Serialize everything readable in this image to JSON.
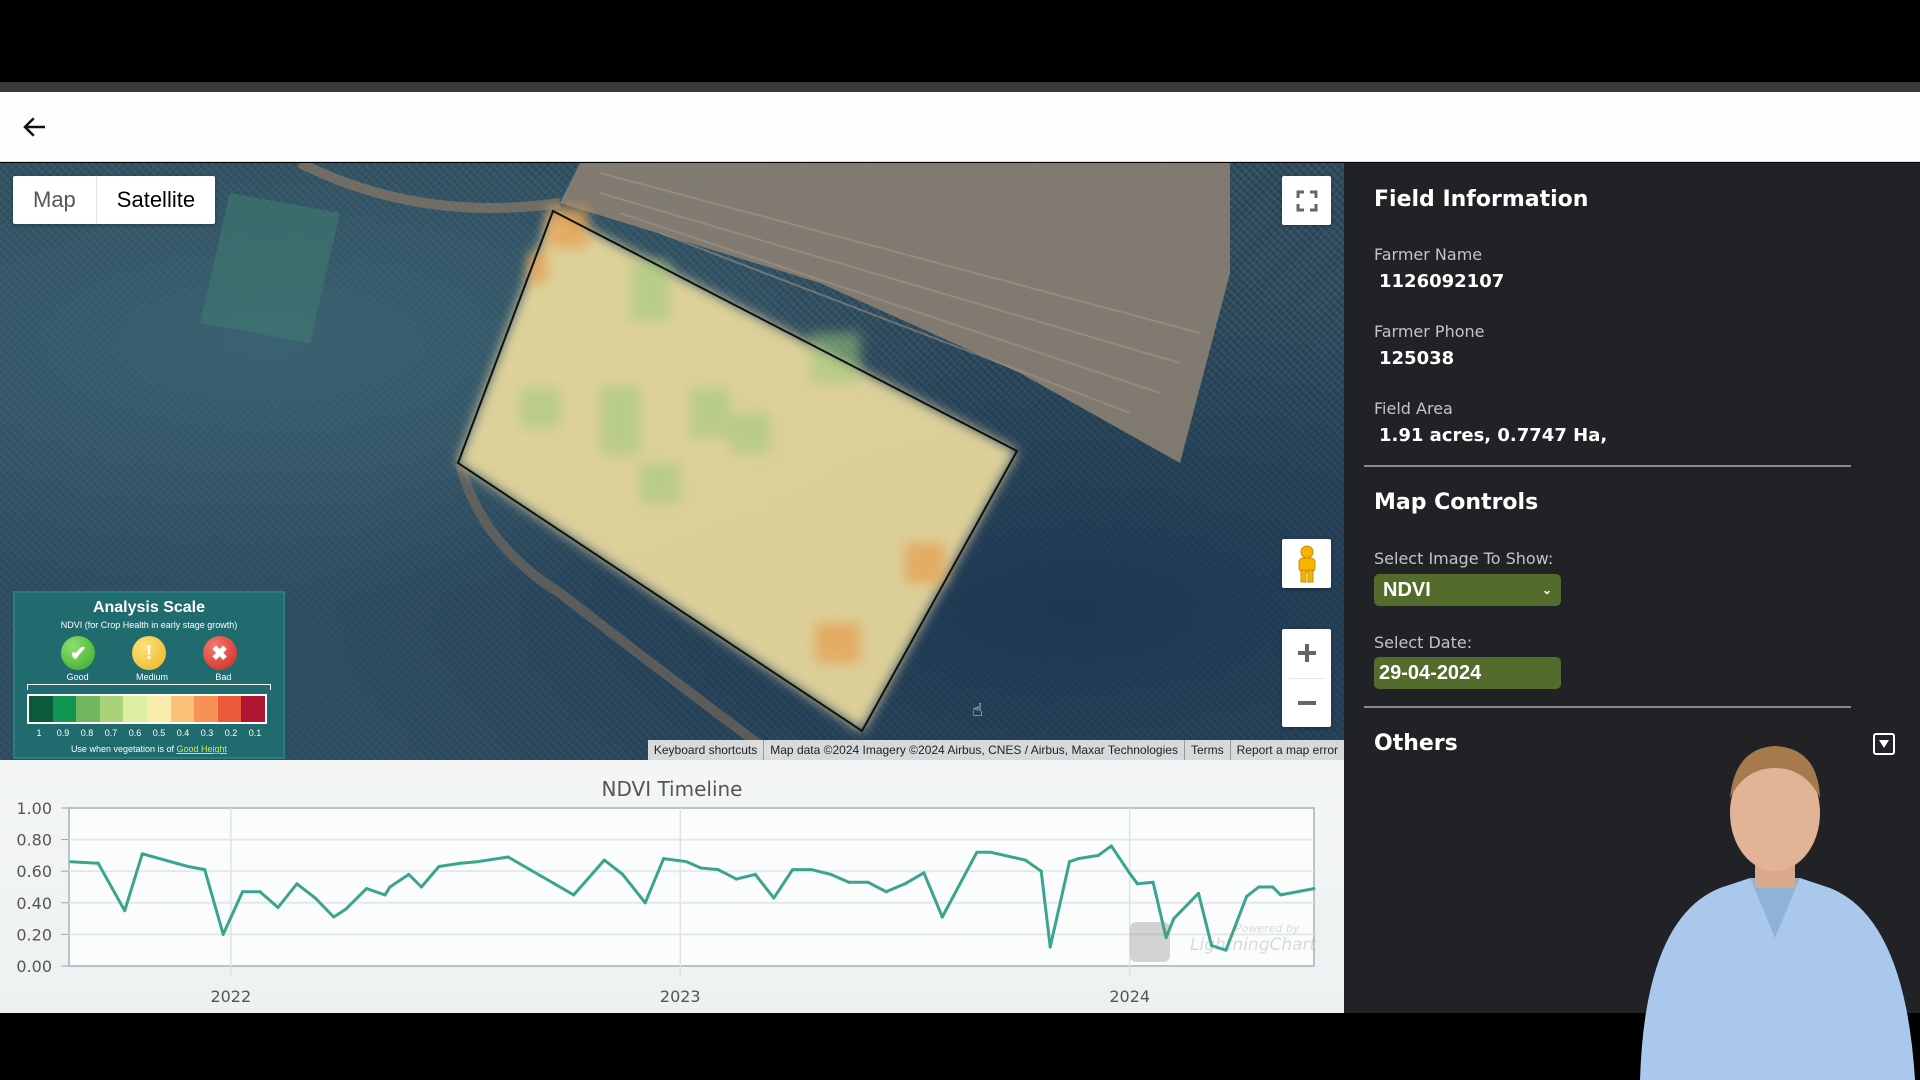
{
  "header": {
    "back_icon": "arrow-left-icon"
  },
  "map": {
    "type_buttons": [
      {
        "label": "Map",
        "selected": false
      },
      {
        "label": "Satellite",
        "selected": true
      }
    ],
    "controls": {
      "fullscreen_icon": "fullscreen-icon",
      "pegman_icon": "street-view-pegman-icon",
      "zoom_in_icon": "plus-icon",
      "zoom_out_icon": "minus-icon"
    },
    "attribution": [
      "Keyboard shortcuts",
      "Map data ©2024 Imagery ©2024 Airbus, CNES / Airbus, Maxar Technologies",
      "Terms",
      "Report a map error"
    ],
    "legend": {
      "title": "Analysis Scale",
      "subtitle": "NDVI (for Crop Health in early stage growth)",
      "levels": [
        {
          "label": "Good",
          "icon": "check-circle-icon",
          "glyph": "✔"
        },
        {
          "label": "Medium",
          "icon": "exclamation-circle-icon",
          "glyph": "!"
        },
        {
          "label": "Bad",
          "icon": "x-circle-icon",
          "glyph": "✖"
        }
      ],
      "colors": [
        "#0b5a3a",
        "#139552",
        "#6fb65f",
        "#a9d378",
        "#dcee9f",
        "#f8ecad",
        "#f9c175",
        "#f59355",
        "#ec5a3a",
        "#b01733"
      ],
      "ticks": [
        "1",
        "0.9",
        "0.8",
        "0.7",
        "0.6",
        "0.5",
        "0.4",
        "0.3",
        "0.2",
        "0.1"
      ],
      "note_prefix": "Use when vegetation is of ",
      "note_link": "Good Height"
    }
  },
  "chart_data": {
    "type": "line",
    "title": "NDVI Timeline",
    "xlabel": "",
    "ylabel": "",
    "ylim": [
      0,
      1
    ],
    "xlim": [
      2021.64,
      2024.41
    ],
    "y_ticks": [
      "1.00",
      "0.80",
      "0.60",
      "0.40",
      "0.20",
      "0.00"
    ],
    "y_tick_values": [
      1.0,
      0.8,
      0.6,
      0.4,
      0.2,
      0.0
    ],
    "x_ticks": [
      "2022",
      "2023",
      "2024"
    ],
    "x_tick_values": [
      2022,
      2023,
      2024
    ],
    "grid": true,
    "watermark": "Powered by LightningChart JS",
    "line_color": "#3aa58c",
    "series": [
      {
        "name": "NDVI",
        "x": [
          2021.644,
          2021.705,
          2021.764,
          2021.803,
          2021.905,
          2021.942,
          2021.983,
          2022.026,
          2022.065,
          2022.105,
          2022.147,
          2022.188,
          2022.229,
          2022.256,
          2022.302,
          2022.343,
          2022.354,
          2022.396,
          2022.424,
          2022.463,
          2022.51,
          2022.549,
          2022.617,
          2022.763,
          2022.831,
          2022.872,
          2022.922,
          2022.963,
          2023.014,
          2023.046,
          2023.084,
          2023.125,
          2023.167,
          2023.208,
          2023.25,
          2023.292,
          2023.335,
          2023.375,
          2023.418,
          2023.458,
          2023.5,
          2023.542,
          2023.583,
          2023.66,
          2023.69,
          2023.768,
          2023.803,
          2023.823,
          2023.866,
          2023.886,
          2023.93,
          2023.959,
          2023.999,
          2024.017,
          2024.052,
          2024.081,
          2024.098,
          2024.153,
          2024.182,
          2024.214,
          2024.26,
          2024.287,
          2024.318,
          2024.336,
          2024.41
        ],
        "values": [
          0.66,
          0.65,
          0.35,
          0.71,
          0.63,
          0.61,
          0.2,
          0.47,
          0.47,
          0.37,
          0.52,
          0.43,
          0.31,
          0.36,
          0.49,
          0.45,
          0.5,
          0.58,
          0.5,
          0.63,
          0.65,
          0.66,
          0.69,
          0.45,
          0.67,
          0.58,
          0.4,
          0.68,
          0.66,
          0.62,
          0.61,
          0.55,
          0.58,
          0.43,
          0.61,
          0.61,
          0.58,
          0.53,
          0.53,
          0.47,
          0.52,
          0.59,
          0.31,
          0.72,
          0.72,
          0.67,
          0.6,
          0.12,
          0.66,
          0.68,
          0.7,
          0.76,
          0.59,
          0.52,
          0.53,
          0.18,
          0.3,
          0.46,
          0.13,
          0.1,
          0.44,
          0.5,
          0.5,
          0.45,
          0.49
        ]
      }
    ]
  },
  "side_panel": {
    "field_info": {
      "title": "Field Information",
      "farmer_name_label": "Farmer Name",
      "farmer_name": "1126092107",
      "farmer_phone_label": "Farmer Phone",
      "farmer_phone": "125038",
      "field_area_label": "Field Area",
      "field_area": "1.91 acres, 0.7747 Ha,"
    },
    "map_controls": {
      "title": "Map Controls",
      "image_label": "Select Image To Show:",
      "image_value": "NDVI",
      "date_label": "Select Date:",
      "date_value": "29-04-2024"
    },
    "others": {
      "title": "Others",
      "toggle_icon": "caret-down-square-icon"
    }
  },
  "colors": {
    "panel_bg": "#202225",
    "select_bg": "#536b2b",
    "legend_bg": "#1f6b6e",
    "chart_line": "#3aa58c"
  }
}
